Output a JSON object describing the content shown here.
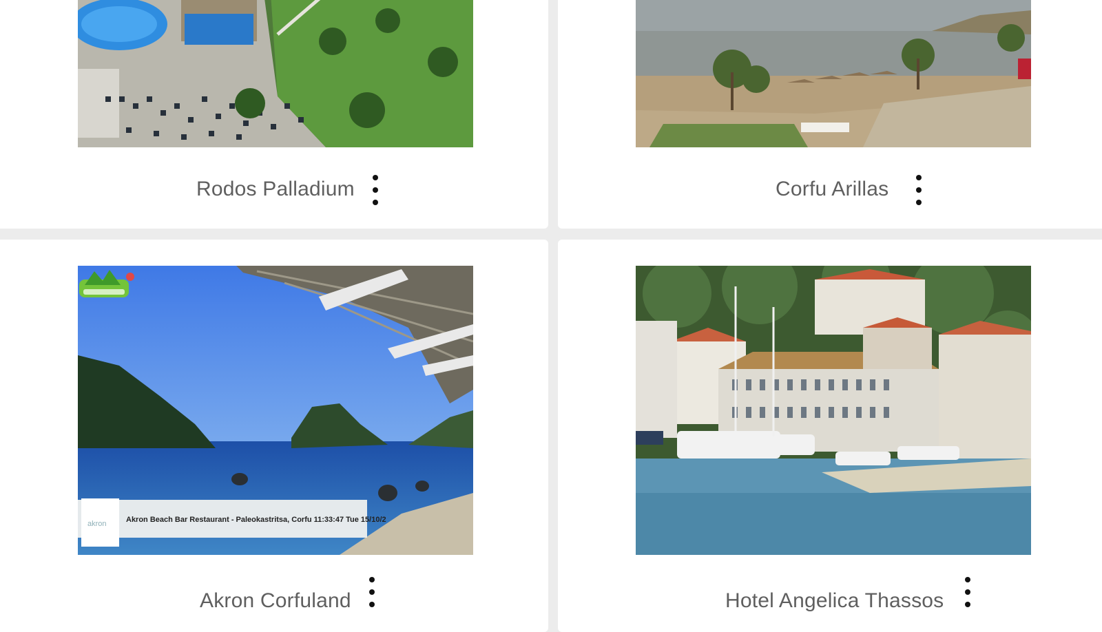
{
  "cards": [
    {
      "title": "Rodos Palladium",
      "menu_icon": "more-vert-icon"
    },
    {
      "title": "Corfu Arillas",
      "menu_icon": "more-vert-icon"
    },
    {
      "title": "Akron Corfuland",
      "menu_icon": "more-vert-icon",
      "overlay_caption": "Akron Beach Bar Restaurant - Paleokastritsa, Corfu 11:33:47  Tue 15/10/2"
    },
    {
      "title": "Hotel Angelica Thassos",
      "menu_icon": "more-vert-icon"
    }
  ],
  "colors": {
    "card_bg": "#ffffff",
    "page_bg": "#ececec",
    "title_text": "#5f5f5f",
    "menu_dots": "#111111"
  }
}
